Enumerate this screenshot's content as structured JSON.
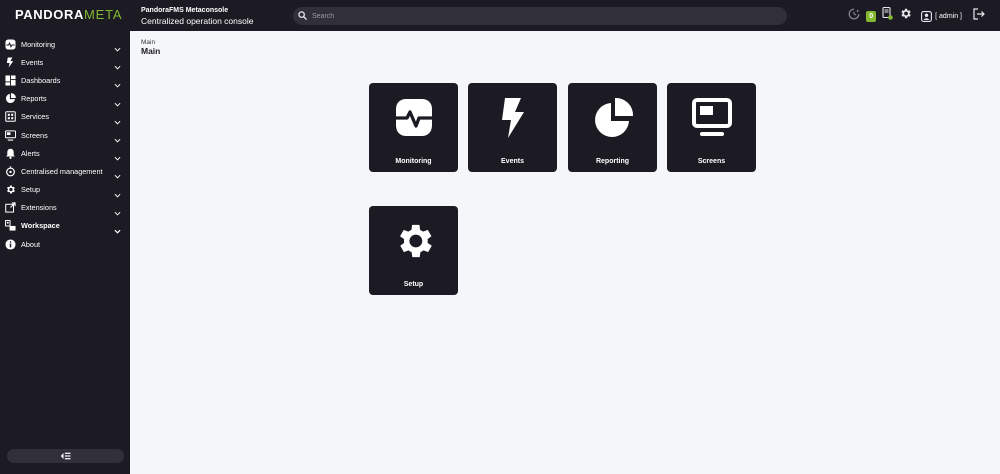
{
  "header": {
    "logo_main": "PANDORA",
    "logo_accent": "META",
    "brand_title": "PandoraFMS Metaconsole",
    "brand_subtitle": "Centralized operation console",
    "search_placeholder": "Search",
    "notifications_count": "0",
    "user_label": "[ admin ]"
  },
  "sidebar": {
    "items": [
      {
        "label": "Monitoring",
        "icon": "monitoring-icon",
        "chevron": true,
        "bold": false
      },
      {
        "label": "Events",
        "icon": "events-icon",
        "chevron": true,
        "bold": false
      },
      {
        "label": "Dashboards",
        "icon": "dashboards-icon",
        "chevron": true,
        "bold": false
      },
      {
        "label": "Reports",
        "icon": "reports-icon",
        "chevron": true,
        "bold": false
      },
      {
        "label": "Services",
        "icon": "services-icon",
        "chevron": true,
        "bold": false
      },
      {
        "label": "Screens",
        "icon": "screens-icon",
        "chevron": true,
        "bold": false
      },
      {
        "label": "Alerts",
        "icon": "alerts-icon",
        "chevron": true,
        "bold": false
      },
      {
        "label": "Centralised management",
        "icon": "centralised-management-icon",
        "chevron": true,
        "bold": false
      },
      {
        "label": "Setup",
        "icon": "setup-icon",
        "chevron": true,
        "bold": false
      },
      {
        "label": "Extensions",
        "icon": "extensions-icon",
        "chevron": true,
        "bold": false
      },
      {
        "label": "Workspace",
        "icon": "workspace-icon",
        "chevron": true,
        "bold": true
      },
      {
        "label": "About",
        "icon": "about-icon",
        "chevron": false,
        "bold": false
      }
    ]
  },
  "main": {
    "breadcrumb": "Main",
    "title": "Main",
    "tiles": [
      {
        "label": "Monitoring",
        "icon": "monitoring-icon"
      },
      {
        "label": "Events",
        "icon": "events-icon"
      },
      {
        "label": "Reporting",
        "icon": "reporting-icon"
      },
      {
        "label": "Screens",
        "icon": "screens-icon"
      },
      {
        "label": "Setup",
        "icon": "setup-icon"
      }
    ]
  },
  "colors": {
    "sidebar_bg": "#1c1b24",
    "content_bg": "#f5f6fa",
    "accent": "#82b92e",
    "tile_bg": "#1c1b24"
  }
}
